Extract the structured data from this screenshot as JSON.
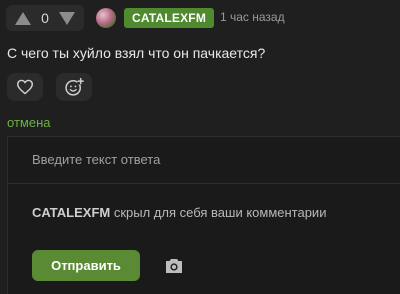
{
  "vote": {
    "count": "0",
    "up_icon": "triangle-up-icon",
    "down_icon": "triangle-down-icon"
  },
  "comment": {
    "author": "CATALEXFM",
    "time": "1 час назад",
    "text": "С чего ты хуйло взял что он пачкается?",
    "like_icon": "heart-icon",
    "react_icon": "add-emoji-icon"
  },
  "reply": {
    "cancel_label": "отмена",
    "placeholder": "Введите текст ответа",
    "hidden_user": "CATALEXFM",
    "hidden_note": " скрыл для себя ваши комментарии",
    "submit_label": "Отправить",
    "attach_icon": "camera-icon"
  },
  "colors": {
    "accent": "#4f8a2f",
    "link": "#6db33f",
    "background": "#1f1f1f"
  }
}
